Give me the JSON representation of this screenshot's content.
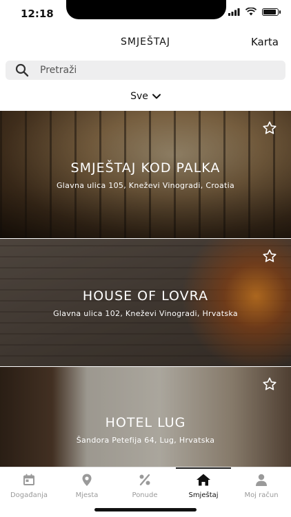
{
  "status_bar": {
    "time": "12:18",
    "battery_level": 0.9
  },
  "nav": {
    "title": "SMJEŠTAJ",
    "action_label": "Karta"
  },
  "search": {
    "placeholder": "Pretraži",
    "icon": "search-icon"
  },
  "filter": {
    "label": "Sve",
    "icon": "chevron-down-icon"
  },
  "listings": [
    {
      "title": "SMJEŠTAJ KOD PALKA",
      "address": "Glavna ulica 105, Kneževi Vinogradi, Croatia",
      "favorite": false
    },
    {
      "title": "HOUSE OF LOVRA",
      "address": "Glavna ulica 102, Kneževi Vinogradi, Hrvatska",
      "favorite": false
    },
    {
      "title": "HOTEL LUG",
      "address": "Šandora Petefija 64, Lug, Hrvatska",
      "favorite": false
    }
  ],
  "tabbar": {
    "items": [
      {
        "label": "Događanja",
        "icon": "calendar-icon",
        "active": false
      },
      {
        "label": "Mjesta",
        "icon": "location-pin-icon",
        "active": false
      },
      {
        "label": "Ponude",
        "icon": "percent-icon",
        "active": false
      },
      {
        "label": "Smještaj",
        "icon": "home-icon",
        "active": true
      },
      {
        "label": "Moj račun",
        "icon": "user-icon",
        "active": false
      }
    ]
  },
  "colors": {
    "active_tab": "#111111",
    "inactive_tab": "#9a9a9a",
    "search_bg": "#eeeeef"
  }
}
